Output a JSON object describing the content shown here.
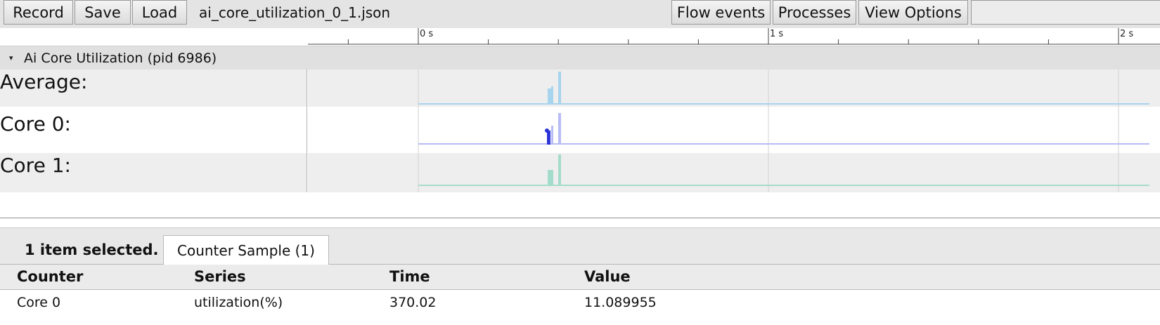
{
  "toolbar": {
    "record_label": "Record",
    "save_label": "Save",
    "load_label": "Load",
    "filename": "ai_core_utilization_0_1.json",
    "flow_events_label": "Flow events",
    "processes_label": "Processes",
    "view_options_label": "View Options"
  },
  "ruler": {
    "ticks": [
      "0 s",
      "1 s",
      "2 s"
    ]
  },
  "process": {
    "caret": "▾",
    "title": "Ai Core Utilization (pid 6986)"
  },
  "tracks": [
    {
      "label": "Average:",
      "color": "#a7d4ee"
    },
    {
      "label": "Core 0:",
      "color": "#b7bcf5"
    },
    {
      "label": "Core 1:",
      "color": "#a4dccb"
    }
  ],
  "selection": {
    "color": "#2d35d8"
  },
  "panel": {
    "selected_count": "1 item selected.",
    "tab_label": "Counter Sample (1)",
    "columns": [
      "Counter",
      "Series",
      "Time",
      "Value"
    ],
    "rows": [
      [
        "Core 0",
        "utilization(%)",
        "370.02",
        "11.089955"
      ]
    ]
  }
}
